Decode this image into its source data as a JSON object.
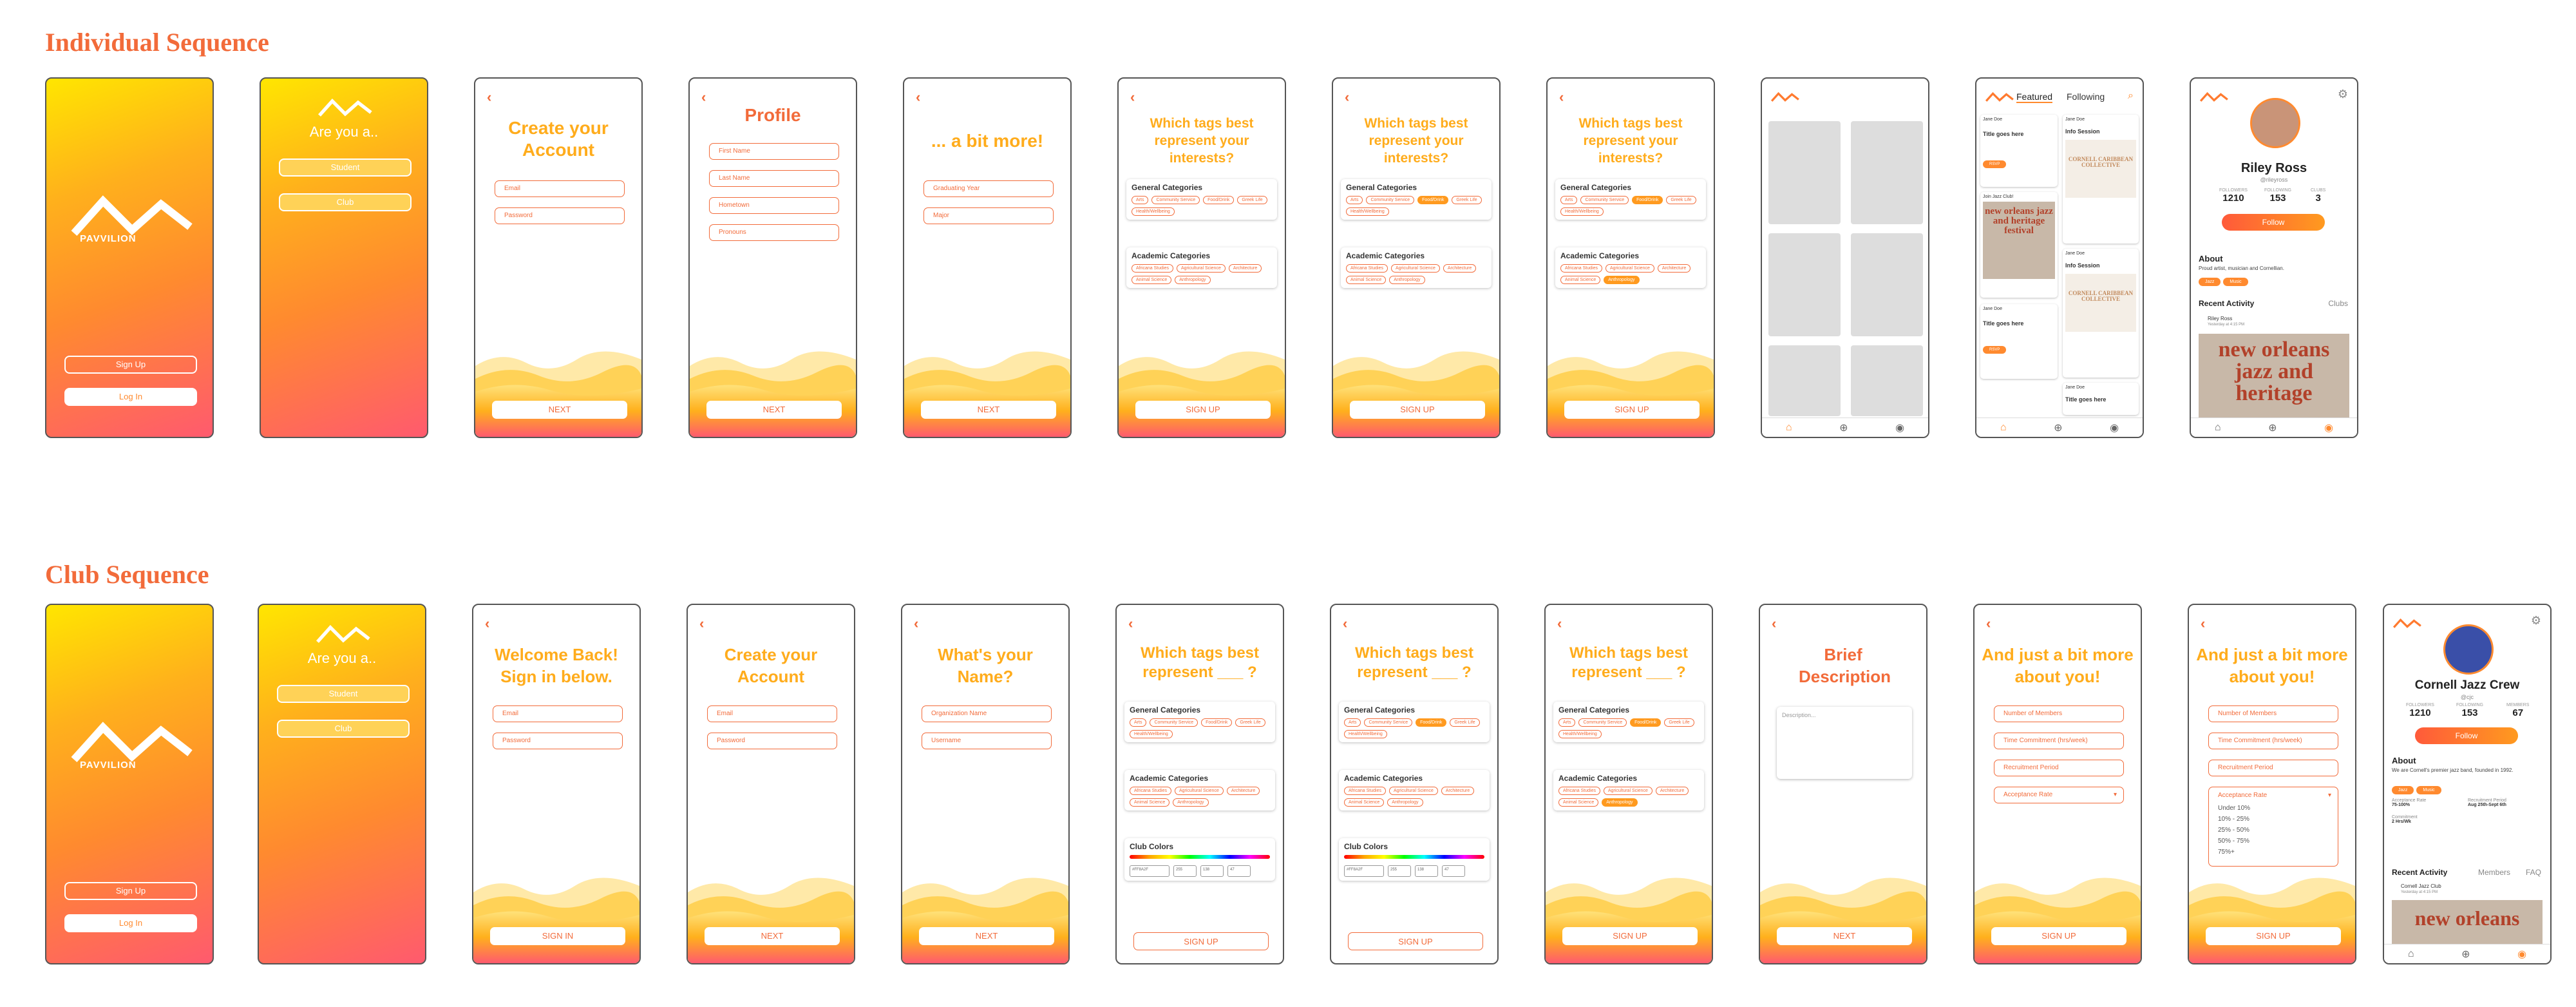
{
  "headings": {
    "individual": "Individual Sequence",
    "club": "Club Sequence"
  },
  "common": {
    "back": "‹",
    "logo_text": "PAVVILION",
    "signup": "Sign Up",
    "login": "Log In",
    "are_you": "Are you a..",
    "student": "Student",
    "club": "Club",
    "next": "NEXT",
    "sign_up": "SIGN UP",
    "sign_in": "SIGN IN",
    "general": "General Categories",
    "academic": "Academic Categories",
    "club_colors": "Club Colors"
  },
  "general_tags": [
    "Arts",
    "Community Service",
    "Food/Drink",
    "Greek Life",
    "Health/Wellbeing"
  ],
  "academic_tags": [
    "Africana Studies",
    "Agricultural Science",
    "Architecture",
    "Animal Science",
    "Anthropology"
  ],
  "indiv": {
    "create": {
      "title": "Create your Account",
      "email": "Email",
      "password": "Password"
    },
    "profile": {
      "title": "Profile",
      "fields": [
        "First Name",
        "Last Name",
        "Hometown",
        "Pronouns"
      ]
    },
    "more": {
      "title": "... a bit more!",
      "fields": [
        "Graduating Year",
        "Major"
      ]
    },
    "tags_title": "Which tags best represent your interests?"
  },
  "feed": {
    "tab_featured": "Featured",
    "tab_following": "Following",
    "user": "Jane Doe",
    "post_title": "Title goes here",
    "info": "Info Session",
    "jazz": "Join Jazz Club!",
    "poster": "new orleans jazz and heritage festival",
    "cornell": "CORNELL CARIBBEAN COLLECTIVE",
    "rsvp": "RSVP"
  },
  "profile": {
    "name": "Riley Ross",
    "handle": "@rileyross",
    "followers": "1210",
    "following": "153",
    "clubs": "3",
    "l_followers": "FOLLOWERS",
    "l_following": "FOLLOWING",
    "l_clubs": "CLUBS",
    "follow": "Follow",
    "about": "About",
    "about_text": "Proud artist, musician and Cornellian.",
    "pill1": "Jazz",
    "pill2": "Music",
    "recent": "Recent Activity",
    "clubs_tab": "Clubs",
    "act_user": "Riley Ross",
    "act_time": "Yesterday at 4:15 PM",
    "poster": "new orleans jazz and heritage"
  },
  "club": {
    "welcome": {
      "title": "Welcome Back! Sign in below.",
      "email": "Email",
      "password": "Password"
    },
    "create": {
      "title": "Create your Account",
      "email": "Email",
      "password": "Password"
    },
    "name": {
      "title": "What's your Name?",
      "fields": [
        "Organization Name",
        "Username"
      ]
    },
    "tags_title": "Which tags best represent ___ ?",
    "color_fields": [
      "#FF8A2F",
      "255",
      "138",
      "47"
    ],
    "brief": {
      "title": "Brief Description",
      "placeholder": "Description..."
    },
    "more": {
      "title": "And just a bit more about you!",
      "fields": [
        "Number of Members",
        "Time Commitment (hrs/week)",
        "Recruitment Period",
        "Acceptance Rate"
      ],
      "options": [
        "Under 10%",
        "10% - 25%",
        "25% - 50%",
        "50% - 75%",
        "75%+"
      ]
    }
  },
  "club_profile": {
    "name": "Cornell Jazz Crew",
    "handle": "@cjc",
    "followers": "1210",
    "following": "153",
    "members": "67",
    "l_followers": "FOLLOWERS",
    "l_following": "FOLLOWING",
    "l_members": "MEMBERS",
    "follow": "Follow",
    "about": "About",
    "about_text": "We are Cornell's premier jazz band, founded in 1992.",
    "pill1": "Jazz",
    "pill2": "Music",
    "acc_label": "Acceptance Rate",
    "acc": "75-100%",
    "rec_label": "Recruitment Period",
    "rec": "Aug 25th-Sept 6th",
    "commit_label": "Commitment",
    "commit": "2 Hrs/Wk",
    "recent": "Recent Activity",
    "members_tab": "Members",
    "faq": "FAQ",
    "act_user": "Cornell Jazz Club",
    "act_time": "Yesterday at 4:15 PM",
    "poster": "new orleans"
  }
}
